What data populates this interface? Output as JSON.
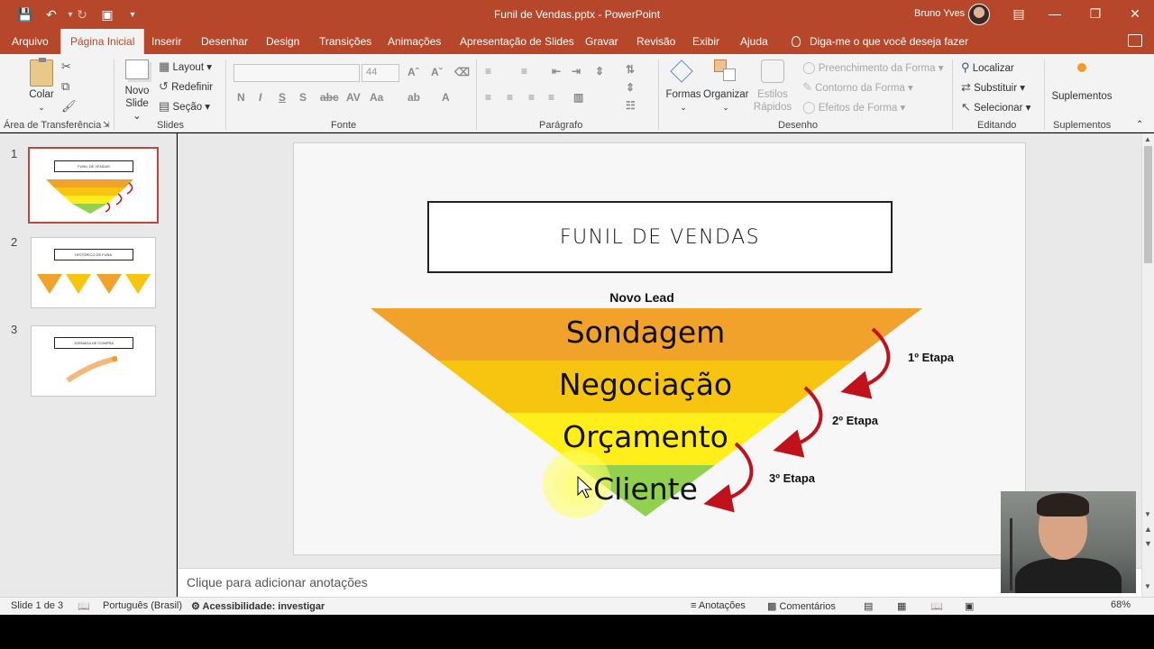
{
  "window": {
    "doc_title": "Funil de Vendas.pptx",
    "separator": " - ",
    "app_name": "PowerPoint",
    "user_name": "Bruno Yves"
  },
  "tabs": [
    {
      "label": "Arquivo"
    },
    {
      "label": "Página Inicial"
    },
    {
      "label": "Inserir"
    },
    {
      "label": "Desenhar"
    },
    {
      "label": "Design"
    },
    {
      "label": "Transições"
    },
    {
      "label": "Animações"
    },
    {
      "label": "Apresentação de Slides"
    },
    {
      "label": "Gravar"
    },
    {
      "label": "Revisão"
    },
    {
      "label": "Exibir"
    },
    {
      "label": "Ajuda"
    }
  ],
  "tellme": "Diga-me o que você deseja fazer",
  "ribbon": {
    "clipboard": {
      "paste": "Colar",
      "label": "Área de Transferência"
    },
    "slides": {
      "new_slide_line1": "Novo",
      "new_slide_line2": "Slide",
      "layout": "Layout",
      "reset": "Redefinir",
      "section": "Seção",
      "label": "Slides"
    },
    "font": {
      "size": "44",
      "label": "Fonte"
    },
    "paragraph": {
      "label": "Parágrafo"
    },
    "drawing": {
      "shapes": "Formas",
      "arrange": "Organizar",
      "quick_styles_line1": "Estilos",
      "quick_styles_line2": "Rápidos",
      "fill": "Preenchimento da Forma",
      "outline": "Contorno da Forma",
      "effects": "Efeitos de Forma",
      "label": "Desenho"
    },
    "editing": {
      "find": "Localizar",
      "replace": "Substituir",
      "select": "Selecionar",
      "label": "Editando"
    },
    "addins": {
      "button": "Suplementos",
      "label": "Suplementos"
    }
  },
  "thumbnails": [
    {
      "number": "1",
      "title": "FUNIL DE VENDAS"
    },
    {
      "number": "2",
      "title": "HISTÓRICO DE FUNIL"
    },
    {
      "number": "3",
      "title": "JORNADA DE COMPRA"
    }
  ],
  "slide": {
    "title": "FUNIL DE VENDAS",
    "top_label": "Novo Lead",
    "stages": [
      "Sondagem",
      "Negociação",
      "Orçamento",
      "Cliente"
    ],
    "steps": [
      "1º Etapa",
      "2º Etapa",
      "3º Etapa"
    ],
    "colors": {
      "sondagem": "#f0a22a",
      "negociacao": "#f7c50f",
      "orcamento": "#ffee1a",
      "cliente": "#92d050",
      "arrow": "#c0121b"
    }
  },
  "notes_placeholder": "Clique para adicionar anotações",
  "status": {
    "slide_count": "Slide 1 de 3",
    "language": "Português (Brasil)",
    "accessibility": "Acessibilidade: investigar",
    "notes": "Anotações",
    "comments": "Comentários",
    "zoom": "68%"
  },
  "theme": {
    "accent": "#b7472a"
  }
}
